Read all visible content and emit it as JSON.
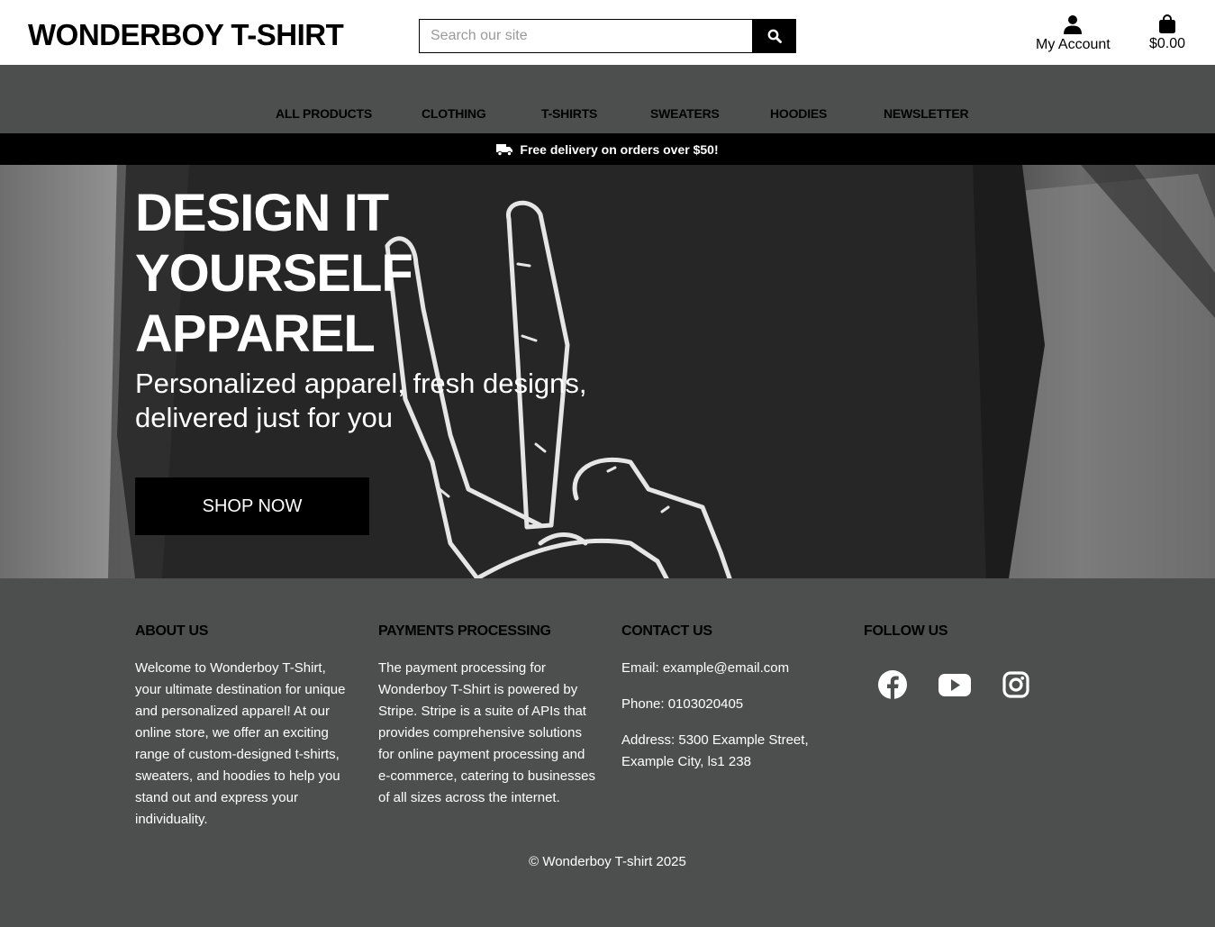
{
  "header": {
    "logo": "WONDERBOY T-SHIRT",
    "search_placeholder": "Search our site",
    "account_label": "My Account",
    "cart_total": "$0.00"
  },
  "nav": {
    "items": [
      "ALL PRODUCTS",
      "CLOTHING",
      "T-SHIRTS",
      "SWEATERS",
      "HOODIES",
      "NEWSLETTER"
    ]
  },
  "delivery_banner": "Free delivery on orders over $50!",
  "hero": {
    "title_line1": "DESIGN IT",
    "title_line2": "YOURSELF",
    "title_line3": "APPAREL",
    "subtitle_line1": "Personalized apparel, fresh designs,",
    "subtitle_line2": "delivered just for you",
    "cta": "SHOP NOW"
  },
  "footer": {
    "about": {
      "heading": "ABOUT US",
      "text": "Welcome to Wonderboy T-Shirt, your ultimate destination for unique and personalized apparel! At our online store, we offer an exciting range of custom-designed t-shirts, sweaters, and hoodies to help you stand out and express your individuality."
    },
    "payments": {
      "heading": "PAYMENTS PROCESSING",
      "text": "The payment processing for Wonderboy T-Shirt is powered by Stripe. Stripe is a suite of APIs that provides comprehensive solutions for online payment processing and e-commerce, catering to businesses of all sizes across the internet."
    },
    "contact": {
      "heading": "CONTACT US",
      "email": "Email: example@email.com",
      "phone": "Phone: 0103020405",
      "address": "Address: 5300 Example Street, Example City, ls1 238"
    },
    "follow": {
      "heading": "FOLLOW US",
      "icons": [
        "facebook-icon",
        "youtube-icon",
        "instagram-icon"
      ]
    },
    "copyright": "© Wonderboy T-shirt 2025"
  },
  "colors": {
    "header_bg": "#ffffff",
    "nav_bg": "#4d4f4f",
    "banner_bg": "#000000",
    "footer_bg": "#4d4f4f",
    "button_bg": "#000000"
  }
}
